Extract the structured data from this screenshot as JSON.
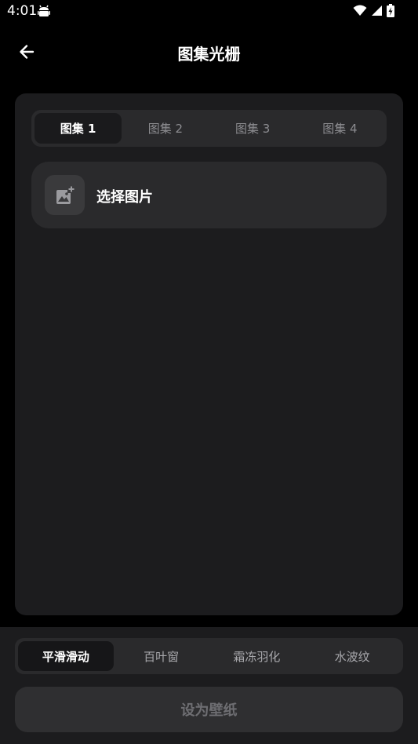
{
  "status_bar": {
    "time": "4:01",
    "notification_icon": "android-debug-icon",
    "wifi_icon": "wifi-icon",
    "signal_icon": "signal-icon",
    "battery_icon": "battery-charging-icon"
  },
  "header": {
    "title": "图集光栅",
    "back_icon": "arrow-left-icon"
  },
  "gallery_tabs": {
    "items": [
      {
        "label": "图集 1",
        "active": true
      },
      {
        "label": "图集 2",
        "active": false
      },
      {
        "label": "图集 3",
        "active": false
      },
      {
        "label": "图集 4",
        "active": false
      }
    ]
  },
  "picker": {
    "icon": "add-photo-icon",
    "label": "选择图片"
  },
  "effect_tabs": {
    "items": [
      {
        "label": "平滑滑动",
        "active": true
      },
      {
        "label": "百叶窗",
        "active": false
      },
      {
        "label": "霜冻羽化",
        "active": false
      },
      {
        "label": "水波纹",
        "active": false
      }
    ]
  },
  "action": {
    "set_wallpaper_label": "设为壁纸"
  },
  "colors": {
    "background": "#000000",
    "card": "#1c1c1e",
    "surface": "#2a2a2c",
    "text_primary": "#ffffff",
    "text_secondary": "#8c8c90",
    "button_disabled_text": "#6e6e72"
  }
}
